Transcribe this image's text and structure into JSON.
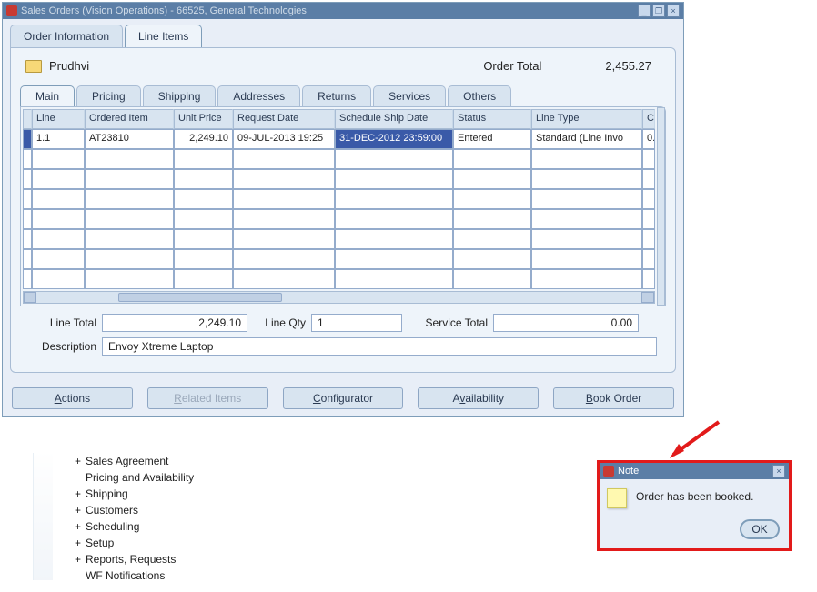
{
  "window": {
    "title": "Sales Orders (Vision Operations) - 66525, General Technologies",
    "min_icon": "_",
    "restore_icon": "❐",
    "close_icon": "×"
  },
  "top_tabs": {
    "order_info": "Order Information",
    "line_items": "Line Items"
  },
  "context": {
    "name": "Prudhvi",
    "order_total_label": "Order Total",
    "order_total_value": "2,455.27"
  },
  "sub_tabs": {
    "main": "Main",
    "pricing": "Pricing",
    "shipping": "Shipping",
    "addresses": "Addresses",
    "returns": "Returns",
    "services": "Services",
    "others": "Others"
  },
  "grid": {
    "headers": {
      "line": "Line",
      "ordered_item": "Ordered Item",
      "unit_price": "Unit Price",
      "request_date": "Request Date",
      "schedule_ship": "Schedule Ship Date",
      "status": "Status",
      "line_type": "Line Type",
      "last": "C"
    },
    "rows": [
      {
        "line": "1.1",
        "ordered_item": "AT23810",
        "unit_price": "2,249.10",
        "request_date": "09-JUL-2013 19:25",
        "schedule_ship": "31-DEC-2012 23:59:00",
        "status": "Entered",
        "line_type": "Standard (Line Invo",
        "last": "0."
      }
    ]
  },
  "footer": {
    "line_total_label": "Line Total",
    "line_total_value": "2,249.10",
    "line_qty_label": "Line Qty",
    "line_qty_value": "1",
    "service_total_label": "Service Total",
    "service_total_value": "0.00",
    "description_label": "Description",
    "description_value": "Envoy Xtreme Laptop"
  },
  "buttons": {
    "actions_pre": "A",
    "actions_rest": "ctions",
    "related_pre": "R",
    "related_rest": "elated Items",
    "configurator_pre": "C",
    "configurator_rest": "onfigurator",
    "availability_pre": "A",
    "availability_mid": "v",
    "availability_rest": "ailability",
    "book_pre": "B",
    "book_rest": "ook Order"
  },
  "nav_tree": {
    "items": [
      {
        "expander": "+",
        "label": "Sales Agreement"
      },
      {
        "expander": "",
        "label": "Pricing and Availability"
      },
      {
        "expander": "+",
        "label": "Shipping"
      },
      {
        "expander": "+",
        "label": "Customers"
      },
      {
        "expander": "+",
        "label": "Scheduling"
      },
      {
        "expander": "+",
        "label": "Setup"
      },
      {
        "expander": "+",
        "label": "Reports, Requests"
      },
      {
        "expander": "",
        "label": "WF Notifications"
      }
    ]
  },
  "note": {
    "title": "Note",
    "message": "Order has been booked.",
    "ok_pre": "O",
    "ok_rest": "K",
    "close_icon": "×"
  }
}
